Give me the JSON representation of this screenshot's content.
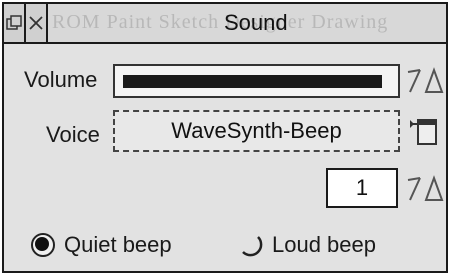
{
  "window": {
    "title": "Sound",
    "title_ghost": "ROM Paint Sketch Designer Drawing",
    "buttons": {
      "back": "back-icon",
      "close": "close-icon"
    }
  },
  "volume": {
    "label": "Volume",
    "level": 0.97,
    "adjust_icon": "adjust-arrows-icon"
  },
  "voice": {
    "label": "Voice",
    "value": "WaveSynth-Beep",
    "menu_icon": "popup-menu-icon"
  },
  "channel": {
    "value": "1",
    "adjust_icon": "adjust-arrows-icon"
  },
  "beep": {
    "options": [
      {
        "label": "Quiet beep",
        "selected": true
      },
      {
        "label": "Loud beep",
        "selected": false
      }
    ]
  },
  "colors": {
    "window_bg": "#e2e2e2",
    "border": "#1a1a1a",
    "slider_fill": "#1a1a1a",
    "field_bg": "#ffffff"
  }
}
